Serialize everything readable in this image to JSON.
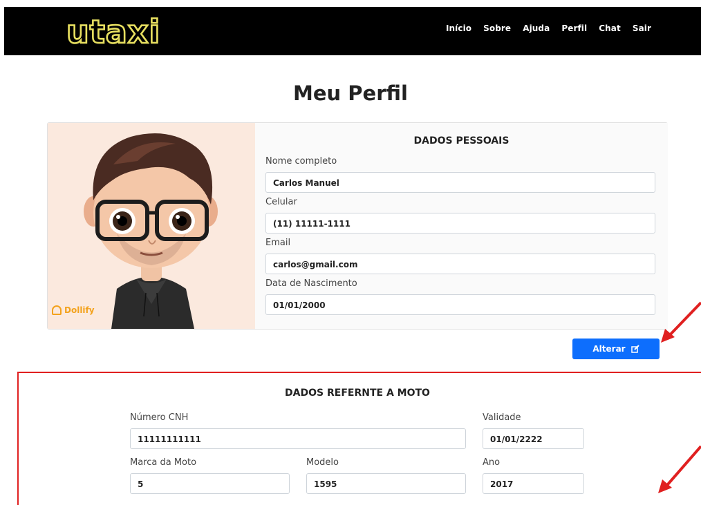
{
  "navbar": {
    "logo": "utaxi",
    "links": [
      "Início",
      "Sobre",
      "Ajuda",
      "Perfil",
      "Chat",
      "Sair"
    ]
  },
  "page_title": "Meu Perfil",
  "avatar": {
    "watermark": "Dollify"
  },
  "personal": {
    "title": "DADOS PESSOAIS",
    "fields": [
      {
        "label": "Nome completo",
        "value": "Carlos Manuel"
      },
      {
        "label": "Celular",
        "value": "(11) 11111-1111"
      },
      {
        "label": "Email",
        "value": "carlos@gmail.com"
      },
      {
        "label": "Data de Nascimento",
        "value": "01/01/2000"
      }
    ]
  },
  "alter_button": {
    "label": "Alterar",
    "icon": "edit-icon"
  },
  "moto": {
    "title": "DADOS REFERNTE A MOTO",
    "fields": {
      "cnh": {
        "label": "Número CNH",
        "value": "11111111111"
      },
      "validade": {
        "label": "Validade",
        "value": "01/01/2222"
      },
      "marca": {
        "label": "Marca da Moto",
        "value": "5"
      },
      "modelo": {
        "label": "Modelo",
        "value": "1595"
      },
      "ano": {
        "label": "Ano",
        "value": "2017"
      }
    }
  },
  "colors": {
    "navbar": "#000000",
    "logo_glow": "#e8e060",
    "primary_button": "#0d6efd",
    "annotation_red": "#e02020"
  }
}
